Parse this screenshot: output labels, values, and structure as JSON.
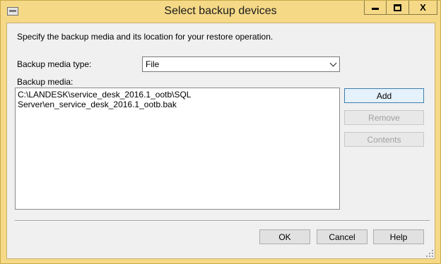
{
  "window": {
    "title": "Select backup devices",
    "caption_buttons": [
      "minimize-icon",
      "maximize-icon",
      "close-icon"
    ],
    "close_glyph": "X"
  },
  "dialog": {
    "description": "Specify the backup media and its location for your restore operation.",
    "media_type_label": "Backup media type:",
    "media_type_value": "File",
    "media_label": "Backup media:",
    "media_items": [
      "C:\\LANDESK\\service_desk_2016.1_ootb\\SQL Server\\en_service_desk_2016.1_ootb.bak"
    ]
  },
  "side_buttons": {
    "add": "Add",
    "remove": "Remove",
    "contents": "Contents"
  },
  "footer_buttons": {
    "ok": "OK",
    "cancel": "Cancel",
    "help": "Help"
  },
  "colors": {
    "title_bar": "#f5d987",
    "client": "#f0f0f0"
  }
}
